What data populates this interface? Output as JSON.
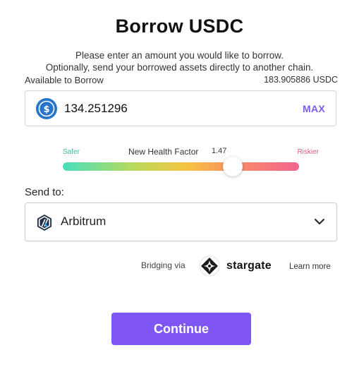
{
  "header": {
    "title": "Borrow USDC"
  },
  "description": {
    "line1": "Please enter an amount you would like to borrow.",
    "line2": "Optionally, send your borrowed assets directly to another chain."
  },
  "available": {
    "label": "Available to Borrow",
    "value": "183.905886 USDC"
  },
  "amount_input": {
    "value": "134.251296",
    "icon": "usdc-icon",
    "max_label": "MAX"
  },
  "health_factor": {
    "safer_label": "Safer",
    "riskier_label": "Riskier",
    "label": "New Health Factor",
    "value": "1.47",
    "level": 0.72
  },
  "send_to": {
    "label": "Send to:",
    "selected_chain": "Arbitrum",
    "icon": "arbitrum-icon"
  },
  "bridge": {
    "label": "Bridging via",
    "provider": "stargate",
    "learn_more": "Learn more"
  },
  "actions": {
    "continue_label": "Continue"
  },
  "colors": {
    "accent": "#7f56f5",
    "max": "#7b5ce6",
    "safer": "#3cb59a",
    "riskier": "#e5598a",
    "usdc_blue": "#2775ca"
  }
}
